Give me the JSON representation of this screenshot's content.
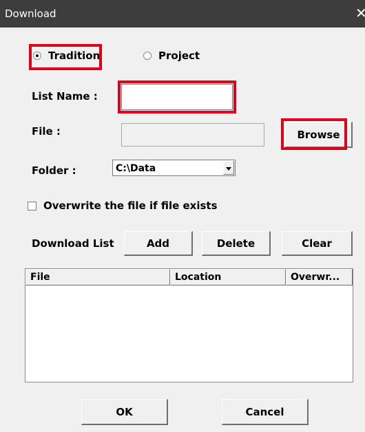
{
  "window": {
    "title": "Download",
    "close_glyph": "✕"
  },
  "mode": {
    "tradition_label": "Tradition",
    "project_label": "Project",
    "selected": "Tradition"
  },
  "form": {
    "list_name_label": "List Name :",
    "list_name_value": "",
    "file_label": "File :",
    "file_value": "",
    "browse_label": "Browse",
    "folder_label": "Folder :",
    "folder_value": "C:\\Data",
    "overwrite_label": "Overwrite the file if file exists",
    "overwrite_checked": false
  },
  "download_list": {
    "label": "Download List",
    "add_label": "Add",
    "delete_label": "Delete",
    "clear_label": "Clear",
    "columns": [
      "File",
      "Location",
      "Overwr..."
    ],
    "rows": []
  },
  "footer": {
    "ok_label": "OK",
    "cancel_label": "Cancel"
  },
  "highlight_color": "#e0001a"
}
